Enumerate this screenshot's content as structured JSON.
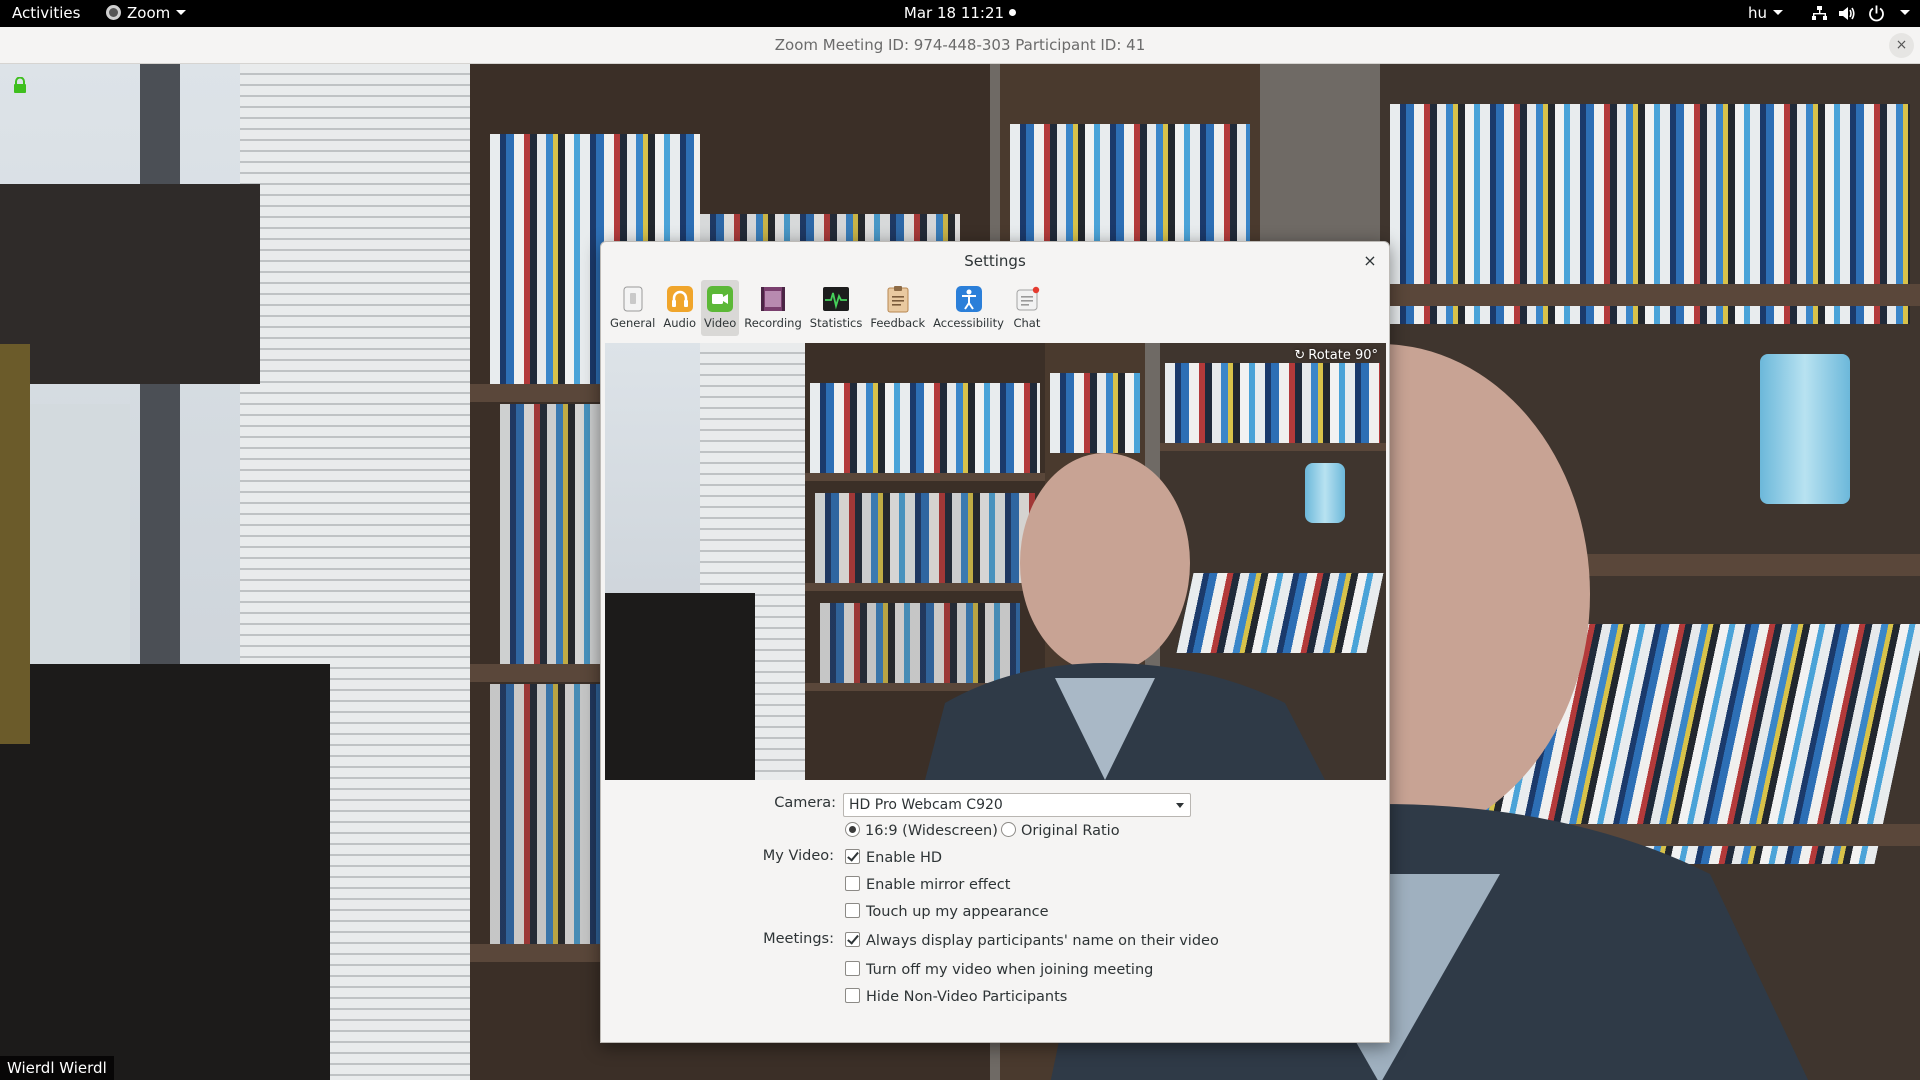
{
  "topbar": {
    "activities": "Activities",
    "app_menu": "Zoom",
    "clock": "Mar 18  11:21",
    "input_language": "hu",
    "icons": [
      "network-icon",
      "volume-icon",
      "power-icon"
    ]
  },
  "zoom_window": {
    "title": "Zoom Meeting ID: 974-448-303 Participant ID: 41",
    "close_symbol": "×",
    "participant_name": "Wierdl Wierdl"
  },
  "settings": {
    "title": "Settings",
    "close_symbol": "×",
    "tabs": [
      {
        "label": "General",
        "icon": "general-icon",
        "active": false
      },
      {
        "label": "Audio",
        "icon": "audio-icon",
        "active": false
      },
      {
        "label": "Video",
        "icon": "video-icon",
        "active": true
      },
      {
        "label": "Recording",
        "icon": "recording-icon",
        "active": false
      },
      {
        "label": "Statistics",
        "icon": "statistics-icon",
        "active": false
      },
      {
        "label": "Feedback",
        "icon": "feedback-icon",
        "active": false
      },
      {
        "label": "Accessibility",
        "icon": "accessibility-icon",
        "active": false
      },
      {
        "label": "Chat",
        "icon": "chat-icon",
        "active": false
      }
    ],
    "preview": {
      "rotate_label": "Rotate 90°"
    },
    "camera": {
      "label": "Camera:",
      "selected": "HD Pro Webcam C920"
    },
    "aspect": {
      "widescreen_label": "16:9 (Widescreen)",
      "widescreen_selected": true,
      "original_label": "Original Ratio",
      "original_selected": false
    },
    "my_video": {
      "label": "My Video:",
      "enable_hd": {
        "label": "Enable HD",
        "checked": true
      },
      "mirror": {
        "label": "Enable mirror effect",
        "checked": false
      },
      "touch_up": {
        "label": "Touch up my appearance",
        "checked": false
      }
    },
    "meetings": {
      "label": "Meetings:",
      "display_names": {
        "label": "Always display participants' name on their video",
        "checked": true
      },
      "turn_off_video": {
        "label": "Turn off my video when joining meeting",
        "checked": false
      },
      "hide_non_video": {
        "label": "Hide Non-Video Participants",
        "checked": false
      }
    }
  },
  "colors": {
    "topbar_bg": "#000000",
    "dialog_bg": "#f5f4f3",
    "active_tab_bg": "#d9d8d6",
    "lock_green": "#3fbf1f"
  }
}
